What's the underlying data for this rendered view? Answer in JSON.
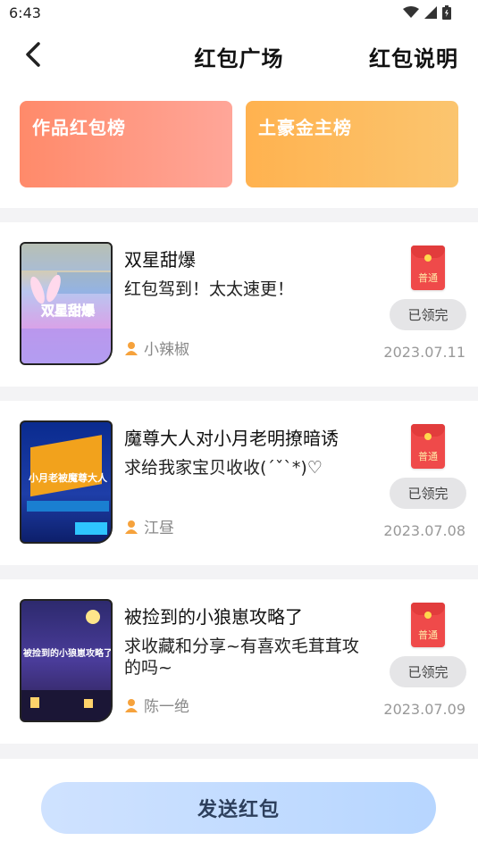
{
  "status_bar": {
    "time": "6:43"
  },
  "header": {
    "title": "红包广场",
    "right_link": "红包说明"
  },
  "rank_cards": [
    {
      "label": "作品红包榜"
    },
    {
      "label": "土豪金主榜"
    }
  ],
  "works": [
    {
      "title": "双星甜爆",
      "description": "红包驾到！太太速更！",
      "author": "小辣椒",
      "envelope_label": "普通",
      "claim_status": "已领完",
      "date": "2023.07.11",
      "cover_text": "双星甜爆"
    },
    {
      "title": "魔尊大人对小月老明撩暗诱",
      "description": "求给我家宝贝收收(ˊˇˋ*)♡",
      "author": "江昼",
      "envelope_label": "普通",
      "claim_status": "已领完",
      "date": "2023.07.08",
      "cover_text": "小月老被魔尊大人"
    },
    {
      "title": "被捡到的小狼崽攻略了",
      "description": "求收藏和分享~有喜欢毛茸茸攻的吗~",
      "author": "陈一绝",
      "envelope_label": "普通",
      "claim_status": "已领完",
      "date": "2023.07.09",
      "cover_text": "被捡到的小狼崽攻略了"
    }
  ],
  "bottom": {
    "send_label": "发送红包"
  }
}
